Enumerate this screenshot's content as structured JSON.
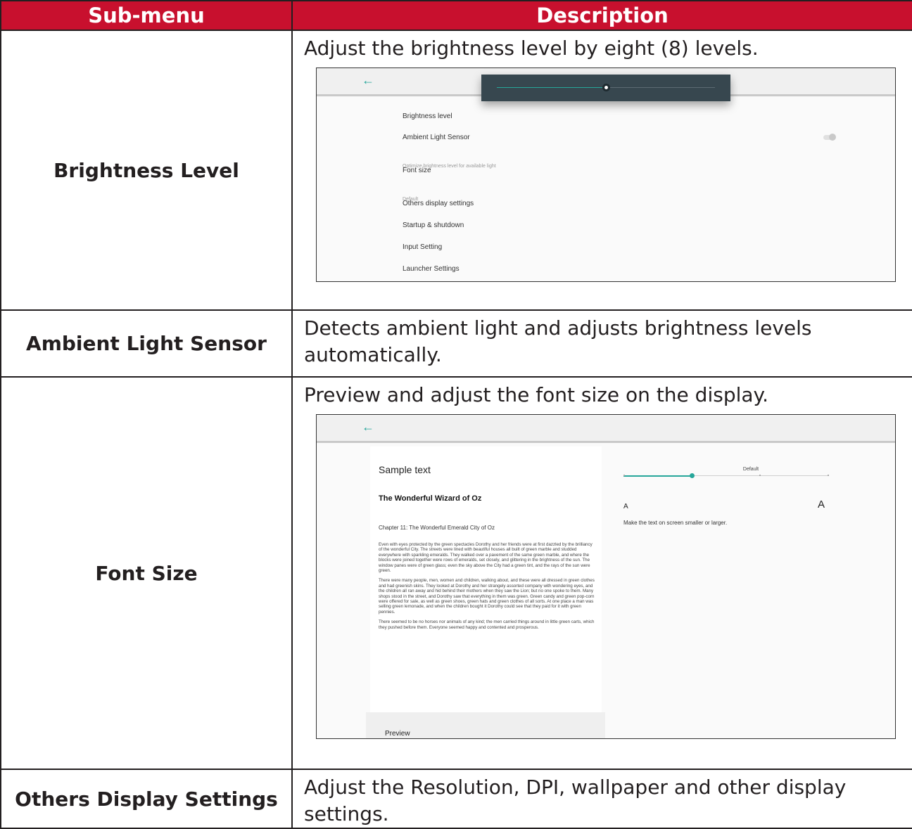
{
  "table": {
    "headers": {
      "submenu": "Sub-menu",
      "description": "Description"
    },
    "rows": [
      {
        "name": "Brightness Level",
        "description": "Adjust the brightness level by eight (8) levels."
      },
      {
        "name": "Ambient Light Sensor",
        "description": "Detects ambient light and adjusts brightness levels automatically."
      },
      {
        "name": "Font Size",
        "description": "Preview and adjust the font size on the display."
      },
      {
        "name": "Others Display Settings",
        "description": "Adjust the Resolution, DPI, wallpaper and other display settings."
      }
    ]
  },
  "shot1": {
    "back_icon": "arrow-left-icon",
    "brightness_slider": {
      "value_fraction": 0.5
    },
    "ambient_toggle": "off",
    "menu": [
      {
        "label": "Brightness level",
        "sub": ""
      },
      {
        "label": "Ambient Light Sensor",
        "sub": "Optimize brightness level for available light"
      },
      {
        "label": "Font size",
        "sub": "Default"
      },
      {
        "label": "Others display settings",
        "sub": ""
      },
      {
        "label": "Startup & shutdown",
        "sub": ""
      },
      {
        "label": "Input Setting",
        "sub": ""
      },
      {
        "label": "Launcher Settings",
        "sub": ""
      }
    ]
  },
  "shot2": {
    "back_icon": "arrow-left-icon",
    "sample_label": "Sample text",
    "book_title": "The Wonderful Wizard of Oz",
    "chapter": "Chapter 11: The Wonderful Emerald City of Oz",
    "paragraphs": [
      "Even with eyes protected by the green spectacles Dorothy and her friends were at first dazzled by the brilliancy of the wonderful City. The streets were lined with beautiful houses all built of green marble and studded everywhere with sparkling emeralds. They walked over a pavement of the same green marble, and where the blocks were joined together were rows of emeralds, set closely, and glittering in the brightness of the sun. The window panes were of green glass; even the sky above the City had a green tint, and the rays of the sun were green.",
      "There were many people, men, women and children, walking about, and these were all dressed in green clothes and had greenish skins. They looked at Dorothy and her strangely assorted company with wondering eyes, and the children all ran away and hid behind their mothers when they saw the Lion; but no one spoke to them. Many shops stood in the street, and Dorothy saw that everything in them was green. Green candy and green pop-corn were offered for sale, as well as green shoes, green hats and green clothes of all sorts. At one place a man was selling green lemonade, and when the children bought it Dorothy could see that they paid for it with green pennies.",
      "There seemed to be no horses nor animals of any kind; the men carried things around in little green carts, which they pushed before them. Everyone seemed happy and contented and prosperous."
    ],
    "preview_label": "Preview",
    "font_size_value": "Default",
    "font_slider": {
      "positions": 4,
      "selected_index": 1
    },
    "small_a": "A",
    "large_a": "A",
    "hint": "Make the text on screen smaller or larger.",
    "accent_color": "#26a69a"
  },
  "colors": {
    "header_bg": "#c8102e",
    "header_text": "#ffffff"
  }
}
